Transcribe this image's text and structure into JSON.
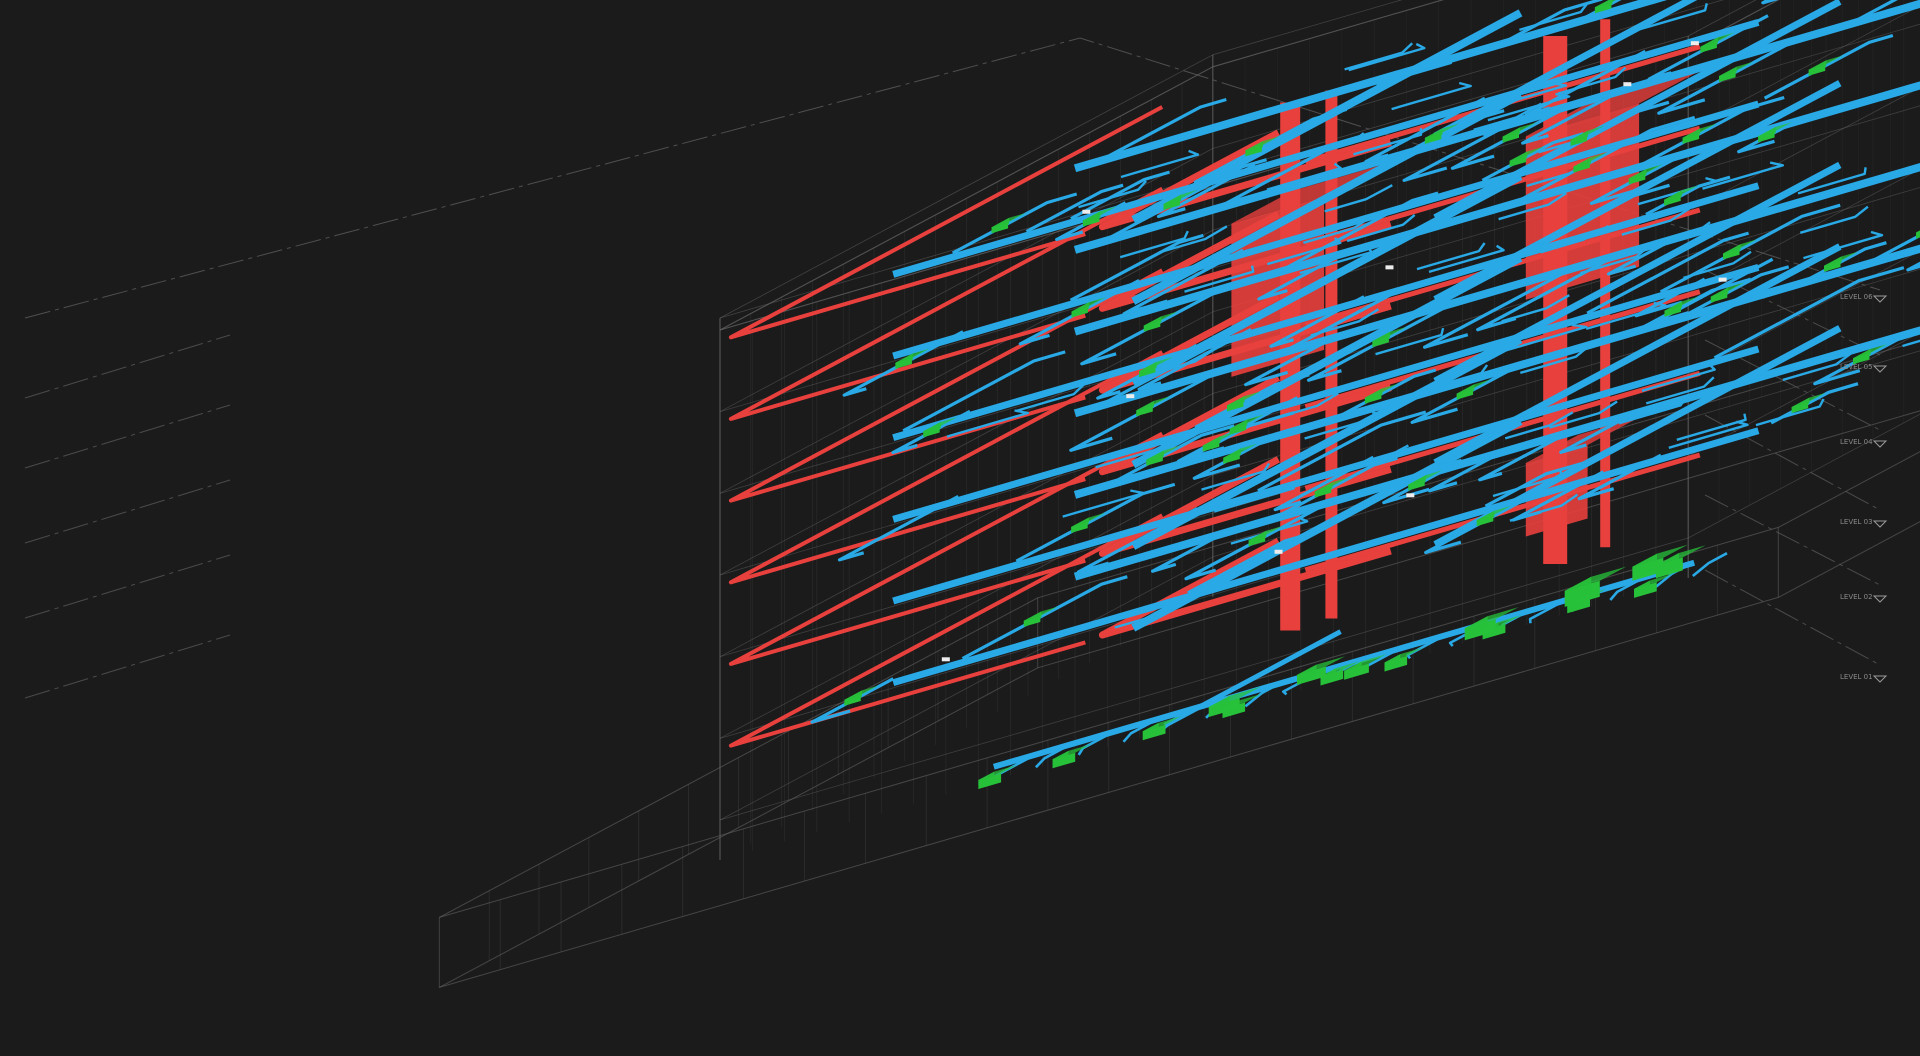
{
  "scene": {
    "background": "#1b1b1b",
    "colors": {
      "duct_supply": "#29a9e6",
      "duct_return": "#e8403d",
      "equipment": "#27c13a",
      "wireframe": "#6a6a6a",
      "level_line": "#7a7a7a",
      "insulation": "#ececec"
    },
    "systems": [
      {
        "name": "supply-duct",
        "color": "#29a9e6"
      },
      {
        "name": "return-duct",
        "color": "#e8403d"
      },
      {
        "name": "hvac-equipment",
        "color": "#27c13a"
      }
    ],
    "level_marker_icon": "level-datum-icon",
    "levels": [
      {
        "tag": "LEVEL 06"
      },
      {
        "tag": "LEVEL 05"
      },
      {
        "tag": "LEVEL 04"
      },
      {
        "tag": "LEVEL 03"
      },
      {
        "tag": "LEVEL 02"
      },
      {
        "tag": "LEVEL 01"
      }
    ]
  }
}
